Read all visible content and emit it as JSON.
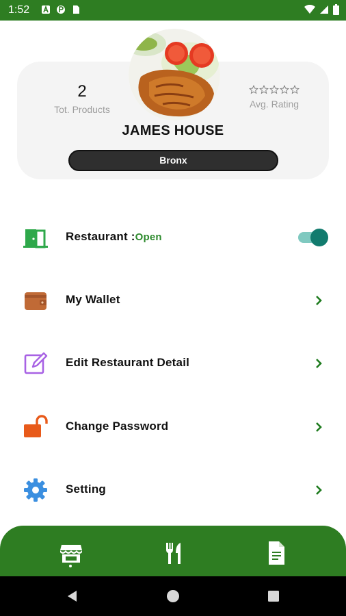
{
  "status_bar": {
    "time": "1:52",
    "left_icons": [
      "a-icon",
      "p-icon",
      "sim-icon"
    ],
    "right_icons": [
      "wifi-icon",
      "signal-icon",
      "battery-icon"
    ]
  },
  "profile": {
    "total_products_value": "2",
    "total_products_label": "Tot. Products",
    "rating_label": "Avg. Rating",
    "rating_stars": 0,
    "rating_max": 5,
    "name": "JAMES HOUSE",
    "location": "Bronx"
  },
  "menu": {
    "restaurant_label": "Restaurant :",
    "restaurant_status": "Open",
    "restaurant_open": true,
    "wallet_label": "My Wallet",
    "edit_label": "Edit Restaurant Detail",
    "password_label": "Change Password",
    "setting_label": "Setting"
  },
  "bottom_nav": {
    "items": [
      "store-icon",
      "fork-knife-icon",
      "document-icon"
    ],
    "active_index": 0
  },
  "colors": {
    "brand_green": "#2e7d22",
    "toggle_on": "#127b6e",
    "status_green": "#2e8b2e"
  }
}
